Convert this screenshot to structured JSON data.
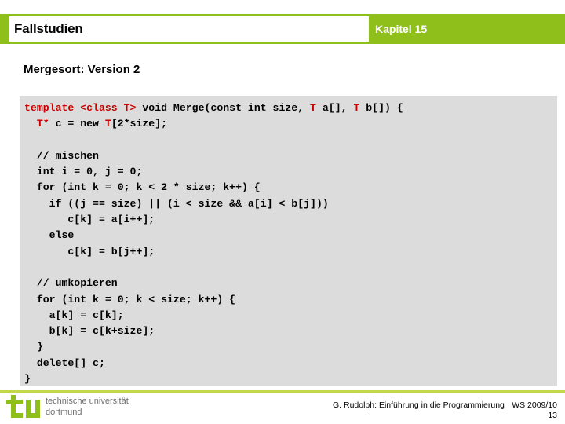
{
  "header": {
    "title": "Fallstudien",
    "chapter": "Kapitel 15",
    "accent_color": "#8fbf1b"
  },
  "slide": {
    "title": "Mergesort: Version 2"
  },
  "code": {
    "background_color": "#dcdcdc",
    "keyword_color": "#cc0000",
    "text_color": "#000000",
    "lines": [
      {
        "segments": [
          {
            "text": "template <class T>",
            "style": "kw"
          },
          {
            "text": " void Merge(const int size, ",
            "style": "plain"
          },
          {
            "text": "T",
            "style": "kw"
          },
          {
            "text": " a[], ",
            "style": "plain"
          },
          {
            "text": "T",
            "style": "kw"
          },
          {
            "text": " b[]) {",
            "style": "plain"
          }
        ]
      },
      {
        "segments": [
          {
            "text": "  ",
            "style": "plain"
          },
          {
            "text": "T*",
            "style": "kw"
          },
          {
            "text": " c = new ",
            "style": "plain"
          },
          {
            "text": "T",
            "style": "kw"
          },
          {
            "text": "[2*size];",
            "style": "plain"
          }
        ]
      },
      {
        "segments": [
          {
            "text": "",
            "style": "plain"
          }
        ]
      },
      {
        "segments": [
          {
            "text": "  // mischen",
            "style": "plain"
          }
        ]
      },
      {
        "segments": [
          {
            "text": "  int i = 0, j = 0;",
            "style": "plain"
          }
        ]
      },
      {
        "segments": [
          {
            "text": "  for (int k = 0; k < 2 * size; k++) {",
            "style": "plain"
          }
        ]
      },
      {
        "segments": [
          {
            "text": "    if ((j == size) || (i < size && a[i] < b[j]))",
            "style": "plain"
          }
        ]
      },
      {
        "segments": [
          {
            "text": "       c[k] = a[i++];",
            "style": "plain"
          }
        ]
      },
      {
        "segments": [
          {
            "text": "    else",
            "style": "plain"
          }
        ]
      },
      {
        "segments": [
          {
            "text": "       c[k] = b[j++];",
            "style": "plain"
          }
        ]
      },
      {
        "segments": [
          {
            "text": "",
            "style": "plain"
          }
        ]
      },
      {
        "segments": [
          {
            "text": "  // umkopieren",
            "style": "plain"
          }
        ]
      },
      {
        "segments": [
          {
            "text": "  for (int k = 0; k < size; k++) {",
            "style": "plain"
          }
        ]
      },
      {
        "segments": [
          {
            "text": "    a[k] = c[k];",
            "style": "plain"
          }
        ]
      },
      {
        "segments": [
          {
            "text": "    b[k] = c[k+size];",
            "style": "plain"
          }
        ]
      },
      {
        "segments": [
          {
            "text": "  }",
            "style": "plain"
          }
        ]
      },
      {
        "segments": [
          {
            "text": "  delete[] c;",
            "style": "plain"
          }
        ]
      },
      {
        "segments": [
          {
            "text": "}",
            "style": "plain"
          }
        ]
      }
    ]
  },
  "footer": {
    "logo_line1": "technische universität",
    "logo_line2": "dortmund",
    "logo_mark_color": "#8fbf1b",
    "credit": "G. Rudolph: Einführung in die Programmierung · WS 2009/10",
    "page_number": "13",
    "rule_color": "#c3d848"
  }
}
